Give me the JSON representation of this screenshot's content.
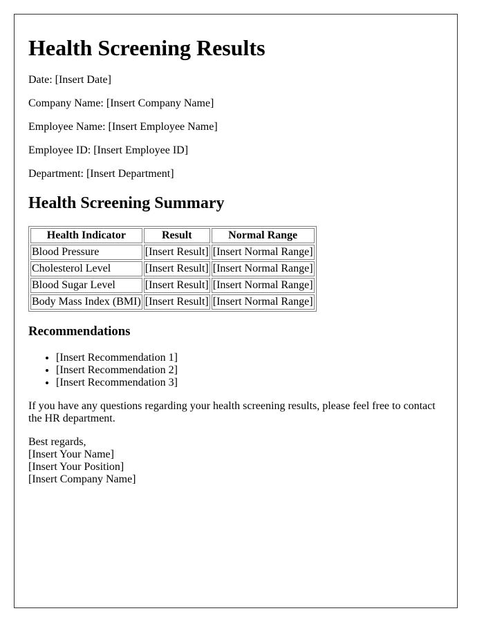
{
  "document": {
    "title": "Health Screening Results",
    "fields": [
      {
        "label": "Date",
        "value": "[Insert Date]",
        "text": "Date: [Insert Date]"
      },
      {
        "label": "Company Name",
        "value": "[Insert Company Name]",
        "text": "Company Name: [Insert Company Name]"
      },
      {
        "label": "Employee Name",
        "value": "[Insert Employee Name]",
        "text": "Employee Name: [Insert Employee Name]"
      },
      {
        "label": "Employee ID",
        "value": "[Insert Employee ID]",
        "text": "Employee ID: [Insert Employee ID]"
      },
      {
        "label": "Department",
        "value": "[Insert Department]",
        "text": "Department: [Insert Department]"
      }
    ],
    "summary": {
      "heading": "Health Screening Summary",
      "table": {
        "headers": [
          "Health Indicator",
          "Result",
          "Normal Range"
        ],
        "rows": [
          [
            "Blood Pressure",
            "[Insert Result]",
            "[Insert Normal Range]"
          ],
          [
            "Cholesterol Level",
            "[Insert Result]",
            "[Insert Normal Range]"
          ],
          [
            "Blood Sugar Level",
            "[Insert Result]",
            "[Insert Normal Range]"
          ],
          [
            "Body Mass Index (BMI)",
            "[Insert Result]",
            "[Insert Normal Range]"
          ]
        ]
      }
    },
    "recommendations": {
      "heading": "Recommendations",
      "items": [
        "[Insert Recommendation 1]",
        "[Insert Recommendation 2]",
        "[Insert Recommendation 3]"
      ]
    },
    "closing_paragraph": "If you have any questions regarding your health screening results, please feel free to contact the HR department.",
    "signature": {
      "salutation": "Best regards,",
      "name": "[Insert Your Name]",
      "position": "[Insert Your Position]",
      "company": "[Insert Company Name]"
    }
  }
}
